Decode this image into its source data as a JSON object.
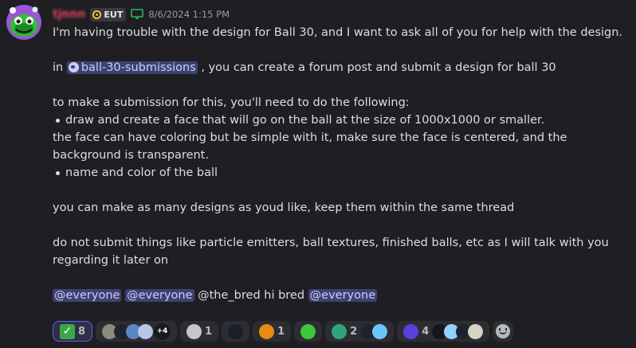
{
  "message": {
    "author": {
      "name": "tjnnn",
      "server_tag": "EUT"
    },
    "timestamp": "8/6/2024 1:15 PM",
    "lines": {
      "intro": "I'm having trouble with the design for Ball 30, and I want to ask all of you for help with the design.",
      "in_word": "in",
      "channel": "ball-30-submissions",
      "channel_suffix": " , you can create a forum post and submit a design for ball 30",
      "to_make": "to make a submission for this, you'll need to do the following:",
      "bullet_1": "draw and create a face that will go on the ball at the size of  1000x1000 or smaller.",
      "face_note": "the face can have coloring but be simple with it, make sure the face is centered, and the background is transparent.",
      "bullet_2": "name and color of the ball",
      "many": "you can make as many designs as youd like, keep them within the same thread",
      "donot": "do not submit things like particle emitters, ball textures, finished balls, etc as I will talk with you regarding it later on"
    },
    "mentions": {
      "m1": "@everyone",
      "m2": "@everyone",
      "plain": " @the_bred hi bred ",
      "m3": "@everyone"
    }
  },
  "reactions": [
    {
      "emoji": "white-check-mark",
      "count": "8",
      "extra": "+4"
    },
    {
      "emoji": "gray-face-ball",
      "count": "1"
    },
    {
      "emoji": "orange-face-ball",
      "count": "1"
    },
    {
      "emoji": "teal-face-ball",
      "count": "2"
    },
    {
      "emoji": "purple-face-ball",
      "count": "4"
    }
  ],
  "colors": {
    "background": "#1f1f23",
    "text": "#dbdee1",
    "mention_bg": "#3e4270",
    "mention_text": "#c9cdfb",
    "author": "#e0455b",
    "reaction_highlight": "#5865f2"
  }
}
